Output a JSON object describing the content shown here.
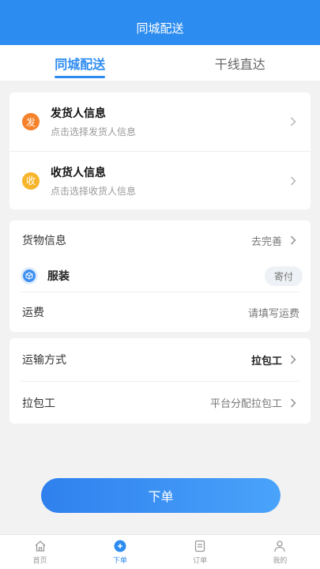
{
  "header": {
    "title": "同城配送"
  },
  "tabs": [
    {
      "label": "同城配送",
      "active": true
    },
    {
      "label": "干线直达",
      "active": false
    }
  ],
  "sender": {
    "badge": "发",
    "title": "发货人信息",
    "subtitle": "点击选择发货人信息"
  },
  "receiver": {
    "badge": "收",
    "title": "收货人信息",
    "subtitle": "点击选择收货人信息"
  },
  "cargo": {
    "label": "货物信息",
    "value": "去完善",
    "item_name": "服装",
    "item_tag": "寄付",
    "freight_label": "运费",
    "freight_value": "请填写运费"
  },
  "transport": {
    "method_label": "运输方式",
    "method_value": "拉包工",
    "porter_label": "拉包工",
    "porter_value": "平台分配拉包工"
  },
  "submit_label": "下单",
  "nav": [
    {
      "label": "首页",
      "icon": "home-icon",
      "active": false
    },
    {
      "label": "下单",
      "icon": "plus-circle-icon",
      "active": true
    },
    {
      "label": "订单",
      "icon": "order-list-icon",
      "active": false
    },
    {
      "label": "我的",
      "icon": "user-icon",
      "active": false
    }
  ],
  "colors": {
    "primary": "#2d8cf0",
    "sender_badge": "#f5822a",
    "receiver_badge": "#f7b52c"
  }
}
